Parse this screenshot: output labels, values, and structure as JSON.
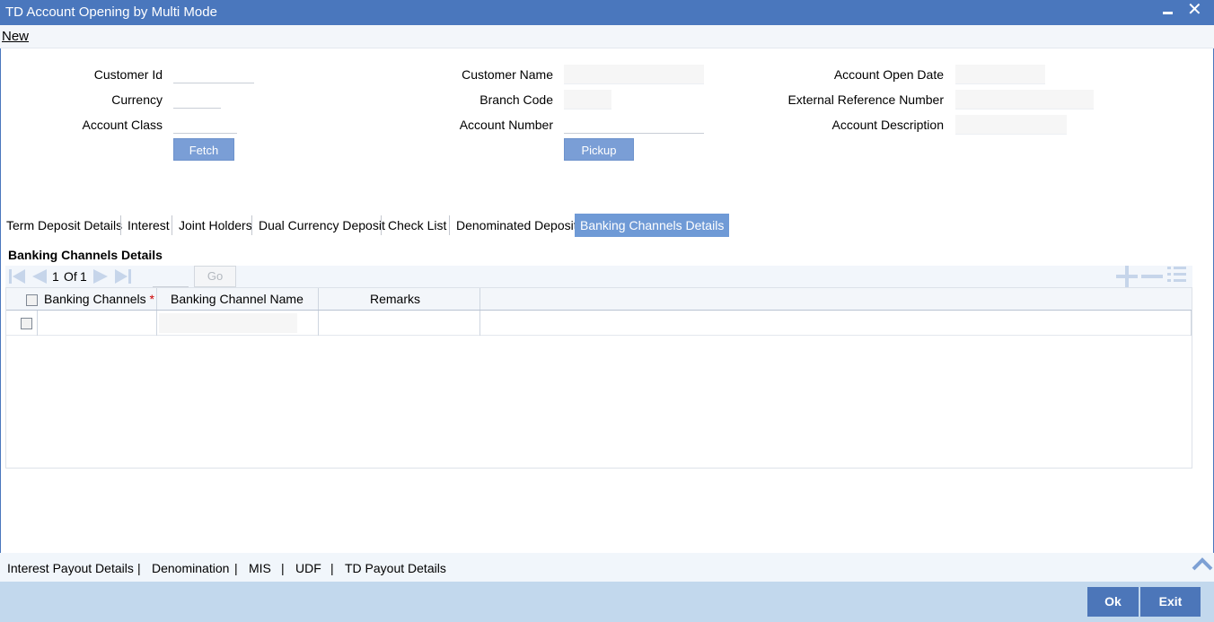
{
  "window": {
    "title": "TD Account Opening by Multi Mode",
    "minimize_icon": "minimize-icon",
    "close_icon": "close-icon",
    "close_glyph": "✕"
  },
  "menu": {
    "new_label": "New"
  },
  "form": {
    "customer_id_label": "Customer Id",
    "customer_id_value": "",
    "currency_label": "Currency",
    "currency_value": "",
    "account_class_label": "Account Class",
    "account_class_value": "",
    "fetch_label": "Fetch",
    "customer_name_label": "Customer Name",
    "customer_name_value": "",
    "branch_code_label": "Branch Code",
    "branch_code_value": "",
    "account_number_label": "Account Number",
    "account_number_value": "",
    "pickup_label": "Pickup",
    "account_open_date_label": "Account Open Date",
    "account_open_date_value": "",
    "external_ref_label": "External Reference Number",
    "external_ref_value": "",
    "account_desc_label": "Account Description",
    "account_desc_value": ""
  },
  "tabs": [
    {
      "label": "Term Deposit Details"
    },
    {
      "label": "Interest"
    },
    {
      "label": "Joint Holders"
    },
    {
      "label": "Dual Currency Deposit"
    },
    {
      "label": "Check List"
    },
    {
      "label": "Denominated Deposit"
    },
    {
      "label": "Banking Channels Details",
      "active": true
    }
  ],
  "section": {
    "title": "Banking Channels Details"
  },
  "pagination": {
    "current": "1",
    "of_label": "Of",
    "total": "1",
    "go_label": "Go",
    "page_input": ""
  },
  "grid": {
    "columns": [
      "Banking Channels",
      "Banking Channel Name",
      "Remarks"
    ],
    "required_marker": "*",
    "rows": [
      {
        "banking_channel": "",
        "banking_channel_name": "",
        "remarks": ""
      }
    ],
    "add_icon": "add-row-icon",
    "delete_icon": "delete-row-icon",
    "view_icon": "single-view-icon"
  },
  "bottom_links": {
    "items": [
      "Interest Payout Details",
      "Denomination",
      "MIS",
      "UDF",
      "TD Payout Details"
    ],
    "separator": "|",
    "collapse_icon": "chevron-up-icon"
  },
  "footer": {
    "ok_label": "Ok",
    "exit_label": "Exit"
  },
  "colors": {
    "titlebar": "#4a77bd",
    "active_tab": "#6f9ad6",
    "button": "#4c76b9",
    "footer": "#c2d8ed"
  }
}
